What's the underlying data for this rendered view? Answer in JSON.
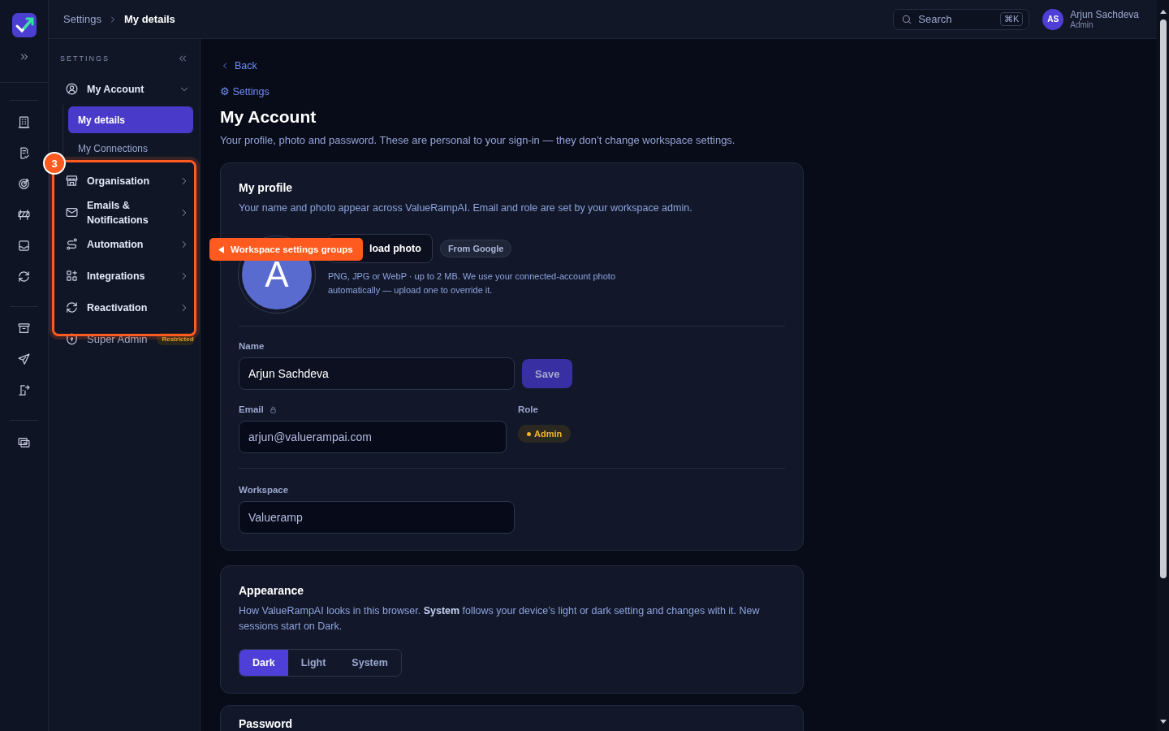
{
  "header": {
    "breadcrumb": [
      {
        "label": "Settings",
        "current": false
      },
      {
        "label": "My details",
        "current": true
      }
    ],
    "search": {
      "placeholder": "Search",
      "shortcut": "⌘K"
    },
    "user": {
      "initials": "AS",
      "name": "Arjun Sachdeva",
      "role": "Admin"
    }
  },
  "sidebar": {
    "heading": "SETTINGS",
    "items": [
      {
        "label": "My Account",
        "kind": "group",
        "expanded": true,
        "selected": false,
        "children": [
          {
            "label": "My details",
            "selected": true
          },
          {
            "label": "My Connections",
            "selected": false
          }
        ]
      },
      {
        "label": "Organisation",
        "kind": "link",
        "selected": false
      },
      {
        "label": "Emails & Notifications",
        "kind": "link",
        "selected": false
      },
      {
        "label": "Automation",
        "kind": "link",
        "selected": false
      },
      {
        "label": "Integrations",
        "kind": "link",
        "selected": false
      },
      {
        "label": "Reactivation",
        "kind": "link",
        "selected": false
      },
      {
        "label": "Super Admin",
        "kind": "restricted",
        "selected": false,
        "badge": "Restricted"
      }
    ]
  },
  "tour": {
    "step": "3",
    "tooltip": "Workspace settings groups"
  },
  "page": {
    "back": "Back",
    "eyebrow": "⚙ Settings",
    "title": "My Account",
    "subtitle": "Your profile, photo and password. These are personal to your sign-in — they don’t change workspace settings."
  },
  "profile": {
    "title": "My profile",
    "description": "Your name and photo appear across ValueRampAI. Email and role are set by your workspace admin.",
    "avatar_letter": "A",
    "upload_label": "load photo",
    "source_tag": "From Google",
    "hint": "PNG, JPG or WebP · up to 2 MB. We use your connected-account photo automatically — upload one to override it.",
    "name": {
      "label": "Name",
      "value": "Arjun Sachdeva",
      "readonly": false
    },
    "save": {
      "label": "Save",
      "disabled": true
    },
    "email": {
      "label": "Email",
      "value": "arjun@valuerampai.com",
      "readonly": true,
      "locked": true
    },
    "role": {
      "label": "Role",
      "badge": "Admin"
    },
    "workspace": {
      "label": "Workspace",
      "value": "Valueramp",
      "readonly": true
    }
  },
  "appearance": {
    "title": "Appearance",
    "description": "How ValueRampAI looks in this browser. **System** follows your device’s light or dark setting and changes with it. New sessions start on Dark.",
    "options": [
      {
        "label": "Dark",
        "selected": true
      },
      {
        "label": "Light",
        "selected": false
      },
      {
        "label": "System",
        "selected": false
      }
    ]
  },
  "password": {
    "title": "Password"
  }
}
